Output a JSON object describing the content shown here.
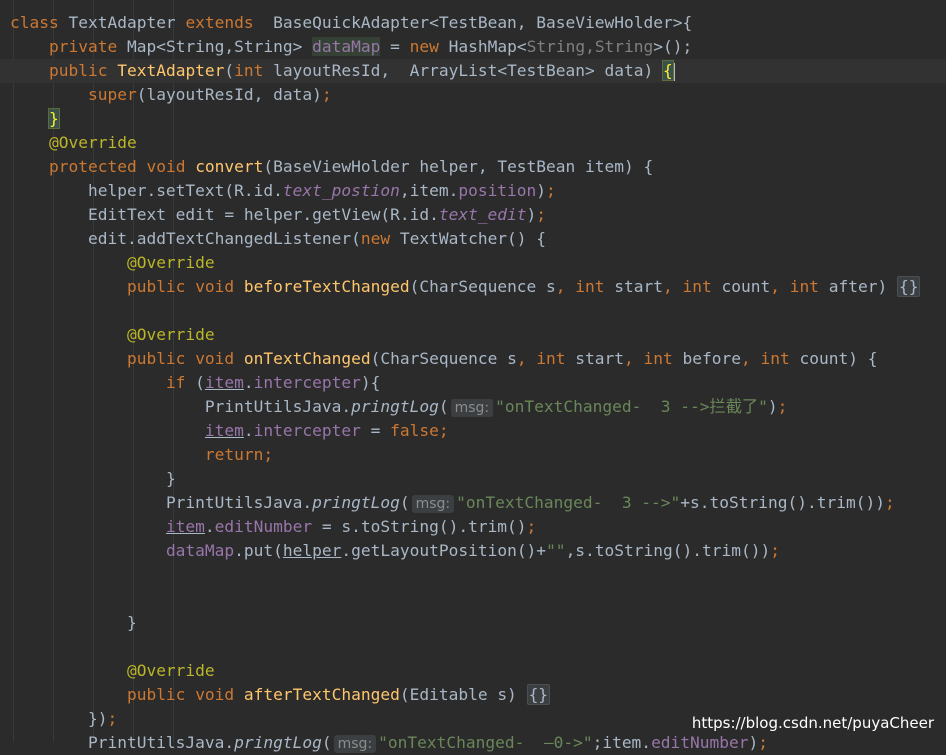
{
  "code": {
    "l1": {
      "k1": "class",
      "t1": " TextAdapter ",
      "k2": "extends",
      "t2": "  BaseQuickAdapter<TestBean, BaseViewHolder>{"
    },
    "l2": {
      "k1": "private",
      "t1": " Map<String,String> ",
      "f1": "dataMap",
      "t2": " = ",
      "k2": "new",
      "t3": " HashMap<",
      "g1": "String,String",
      "t4": ">();"
    },
    "l3": {
      "k1": "public",
      "t1": " ",
      "fn1": "TextAdapter",
      "t2": "(",
      "k2": "int",
      "t3": " layoutResId,  ArrayList<TestBean> data) ",
      "b1": "{"
    },
    "l4": {
      "k1": "super",
      "t1": "(layoutResId, data)",
      "k2": ";"
    },
    "l5": {
      "b1": "}"
    },
    "l6": {
      "a1": "@Override"
    },
    "l7": {
      "k1": "protected",
      "t1": " ",
      "k2": "void",
      "t2": " ",
      "fn1": "convert",
      "t3": "(BaseViewHolder helper, TestBean item) {"
    },
    "l8": {
      "t1": "helper.setText(R.id.",
      "f1": "text_postion",
      "t2": ",item.",
      "f2": "position",
      "t3": ")",
      "k1": ";"
    },
    "l9": {
      "t1": "EditText edit = helper.getView(R.id.",
      "f1": "text_edit",
      "t2": ")",
      "k1": ";"
    },
    "l10": {
      "t1": "edit.addTextChangedListener(",
      "k1": "new",
      "t2": " TextWatcher() {"
    },
    "l11": {
      "a1": "@Override"
    },
    "l12": {
      "k1": "public",
      "t1": " ",
      "k2": "void",
      "t2": " ",
      "fn1": "beforeTextChanged",
      "t3": "(CharSequence s",
      "k3": ",",
      "t4": " ",
      "k4": "int",
      "t5": " start",
      "k5": ",",
      "t6": " ",
      "k6": "int",
      "t7": " count",
      "k7": ",",
      "t8": " ",
      "k8": "int",
      "t9": " after) ",
      "fold": "{}"
    },
    "l13": {
      "a1": "@Override"
    },
    "l14": {
      "k1": "public",
      "t1": " ",
      "k2": "void",
      "t2": " ",
      "fn1": "onTextChanged",
      "t3": "(CharSequence s",
      "k3": ",",
      "t4": " ",
      "k4": "int",
      "t5": " start",
      "k5": ",",
      "t6": " ",
      "k6": "int",
      "t7": " before",
      "k7": ",",
      "t8": " ",
      "k8": "int",
      "t9": " count) {"
    },
    "l15": {
      "k1": "if",
      "t1": " (",
      "u1": "item",
      "t2": ".",
      "f1": "intercepter",
      "t3": "){"
    },
    "l16": {
      "t1": "PrintUtilsJava.",
      "m1": "pringtLog",
      "t2": "(",
      "h1": "msg:",
      "s1": "\"onTextChanged-  3 -->拦截了\"",
      "t3": ")",
      "k1": ";"
    },
    "l17": {
      "u1": "item",
      "t1": ".",
      "f1": "intercepter",
      "t2": " = ",
      "k1": "false;"
    },
    "l18": {
      "k1": "return;"
    },
    "l19": {
      "t1": "}"
    },
    "l20": {
      "t1": "PrintUtilsJava.",
      "m1": "pringtLog",
      "t2": "(",
      "h1": "msg:",
      "s1": "\"onTextChanged-  3 -->\"",
      "t3": "+s.toString().trim())",
      "k1": ";"
    },
    "l21": {
      "u1": "item",
      "t1": ".",
      "f1": "editNumber",
      "t2": " = s.toString().trim()",
      "k1": ";"
    },
    "l22": {
      "f1": "dataMap",
      "t1": ".put(",
      "u1": "helper",
      "t2": ".getLayoutPosition()+",
      "s1": "\"\"",
      "t3": ",s.toString().trim())",
      "k1": ";"
    },
    "l23": {
      "t1": "}"
    },
    "l24": {
      "a1": "@Override"
    },
    "l25": {
      "k1": "public",
      "t1": " ",
      "k2": "void",
      "t2": " ",
      "fn1": "afterTextChanged",
      "t3": "(Editable s) ",
      "fold": "{}"
    },
    "l26": {
      "t1": "})",
      "k1": ";"
    },
    "l27": {
      "t1": "PrintUtilsJava.",
      "m1": "pringtLog",
      "t2": "(",
      "h1": "msg:",
      "s1": "\"onTextChanged-  —0->\"",
      "t3": ";item.",
      "f1": "editNumber",
      "t4": ")",
      "k1": ";"
    }
  },
  "watermark": "https://blog.csdn.net/puyaCheer",
  "colors": {
    "background": "#2b2b2b",
    "keyword": "#cc7832",
    "annotation": "#bbb529",
    "string": "#6a8759",
    "field": "#9876aa",
    "method_decl": "#ffc66d",
    "text": "#a9b7c6"
  }
}
